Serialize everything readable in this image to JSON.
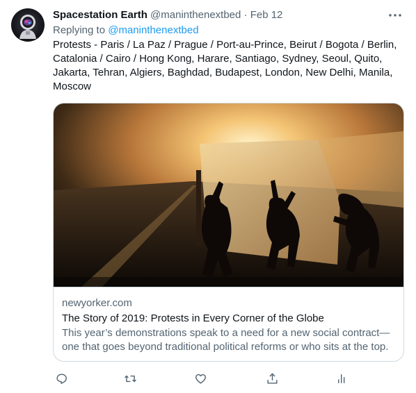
{
  "author": {
    "display_name": "Spacestation Earth",
    "handle": "@maninthenextbed",
    "separator": "·",
    "date": "Feb 12"
  },
  "reply": {
    "prefix": "Replying to",
    "mention": "@maninthenextbed"
  },
  "tweet": {
    "text": "Protests - Paris / La Paz / Prague / Port-au-Prince, Beirut / Bogota / Berlin, Catalonia / Cairo / Hong Kong, Harare, Santiago, Sydney, Seoul, Quito, Jakarta, Tehran, Algiers, Baghdad, Budapest, London, New Delhi, Manila, Moscow"
  },
  "card": {
    "domain": "newyorker.com",
    "title": "The Story of 2019: Protests in Every Corner of the Globe",
    "description": "This year’s demonstrations speak to a need for a new social contract—one that goes beyond traditional political reforms or who sits at the top."
  },
  "icons": {
    "more": "more-horizontal-icon",
    "reply": "reply-icon",
    "retweet": "retweet-icon",
    "like": "heart-icon",
    "share": "share-icon",
    "analytics": "analytics-icon"
  },
  "colors": {
    "text": "#0f1419",
    "secondary": "#536471",
    "link": "#1d9bf0",
    "border": "#cfd9de"
  }
}
